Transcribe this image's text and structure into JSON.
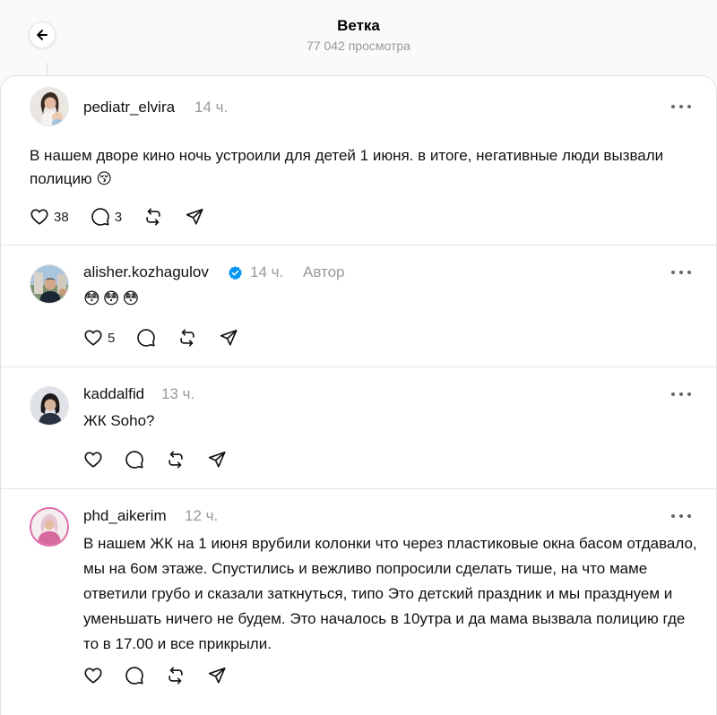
{
  "header": {
    "title": "Ветка",
    "views": "77 042 просмотра"
  },
  "posts": [
    {
      "username": "pediatr_elvira",
      "time": "14 ч.",
      "text": "В нашем дворе кино ночь устроили для детей 1 июня. в итоге, негативные люди вызвали полицию 😚",
      "likes": "38",
      "replies": "3"
    },
    {
      "username": "alisher.kozhagulov",
      "time": "14 ч.",
      "author_label": "Автор",
      "text": "😳😳😳",
      "likes": "5",
      "replies": ""
    },
    {
      "username": "kaddalfid",
      "time": "13 ч.",
      "text": "ЖК Soho?",
      "likes": "",
      "replies": ""
    },
    {
      "username": "phd_aikerim",
      "time": "12 ч.",
      "text": "В нашем ЖК на 1 июня врубили колонки что через пластиковые окна басом отдавало, мы на 6ом этаже. Спустились и вежливо попросили сделать тише, на что маме ответили грубо и сказали заткнуться, типо Это детский праздник и мы празднуем и уменьшать ничего не будем. Это началось в 10утра и да мама вызвала полицию где то в 17.00 и все прикрыли.",
      "likes": "",
      "replies": ""
    }
  ],
  "icons": [
    "back-arrow-icon",
    "heart-icon",
    "comment-icon",
    "repost-icon",
    "share-icon",
    "more-icon",
    "verified-badge-icon"
  ],
  "colors": {
    "accent": "#0095f6",
    "muted": "#999999",
    "text": "#111111"
  }
}
